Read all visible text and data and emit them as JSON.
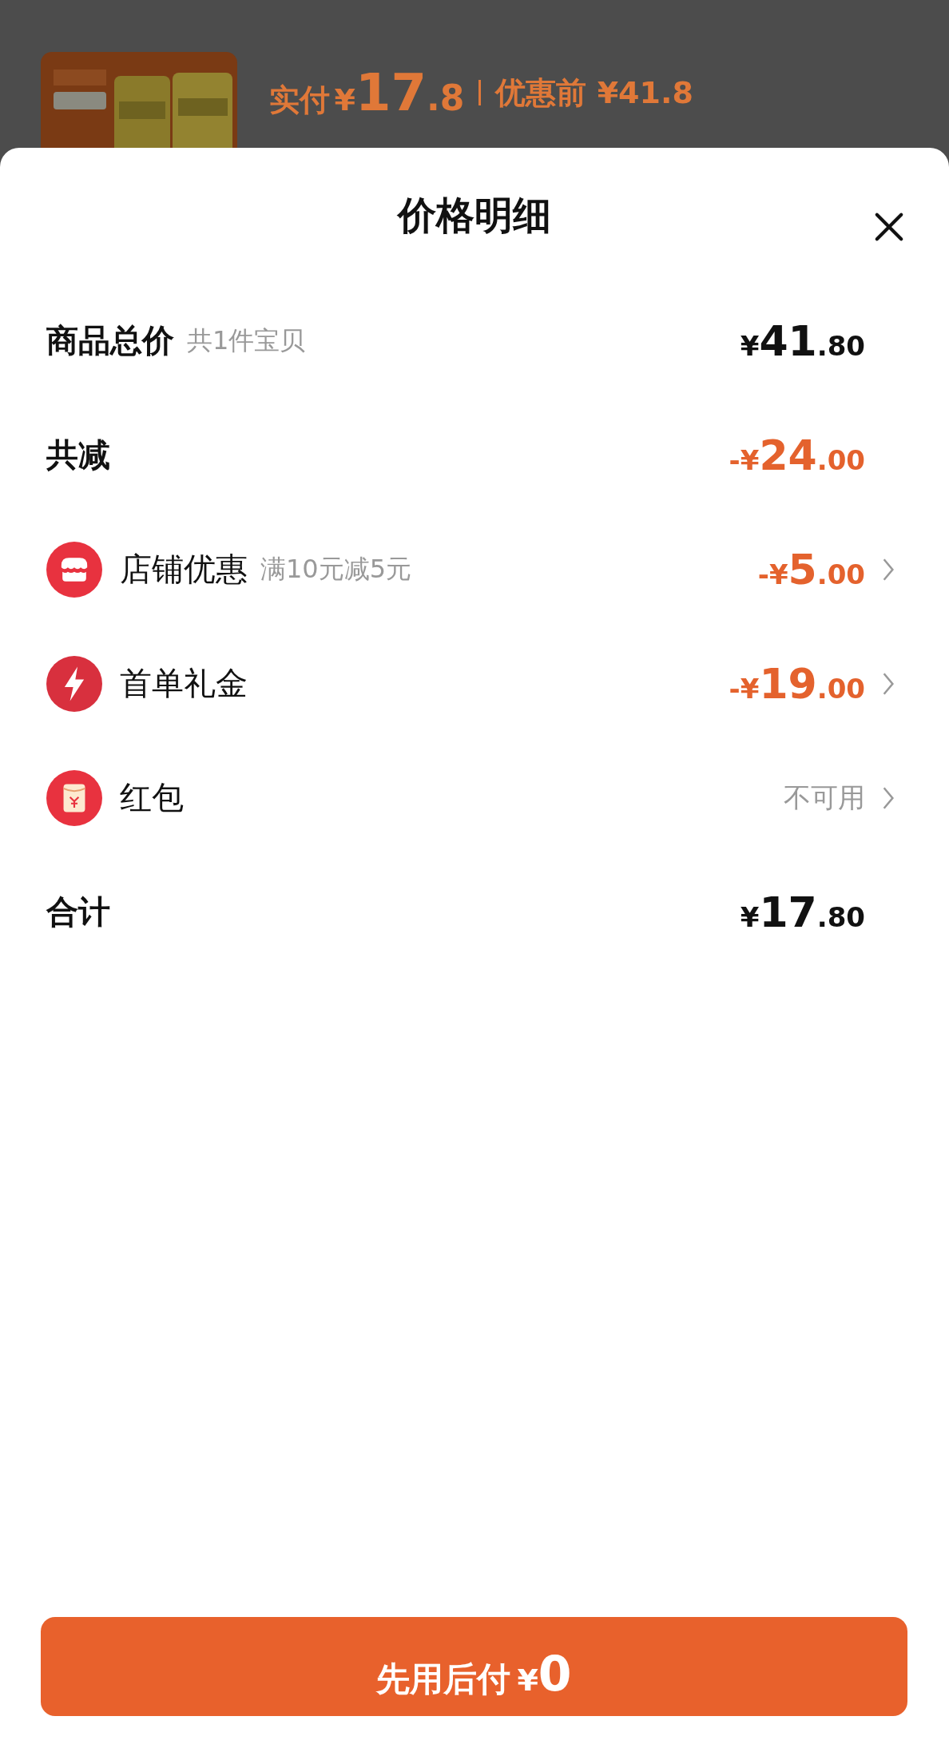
{
  "background": {
    "kind": "picture",
    "paid": {
      "label": "实付",
      "currency": "¥",
      "integer": "17",
      "decimal": ".8"
    },
    "original_price": "优惠前 ¥41.8"
  },
  "sheet": {
    "title": "价格明细",
    "rows": [
      {
        "kind": "heading",
        "label": "商品总价",
        "note": "共1件宝贝",
        "amount": {
          "prefix": "¥",
          "integer": "41",
          "decimal": ".80",
          "discount": false
        }
      },
      {
        "kind": "heading",
        "label": "共减",
        "amount": {
          "prefix": "-¥",
          "integer": "24",
          "decimal": ".00",
          "discount": true
        }
      },
      {
        "kind": "shop",
        "label": "店铺优惠",
        "note": "满10元减5元",
        "amount": {
          "prefix": "-¥",
          "integer": "5",
          "decimal": ".00",
          "discount": true
        }
      },
      {
        "kind": "gift",
        "label": "首单礼金",
        "amount": {
          "prefix": "-¥",
          "integer": "19",
          "decimal": ".00",
          "discount": true
        }
      },
      {
        "kind": "packet",
        "label": "红包",
        "status": "不可用"
      },
      {
        "kind": "heading",
        "label": "合计",
        "amount": {
          "prefix": "¥",
          "integer": "17",
          "decimal": ".80",
          "discount": false
        }
      }
    ],
    "button": {
      "label": "先用后付",
      "currency": "¥",
      "amount": "0"
    }
  }
}
